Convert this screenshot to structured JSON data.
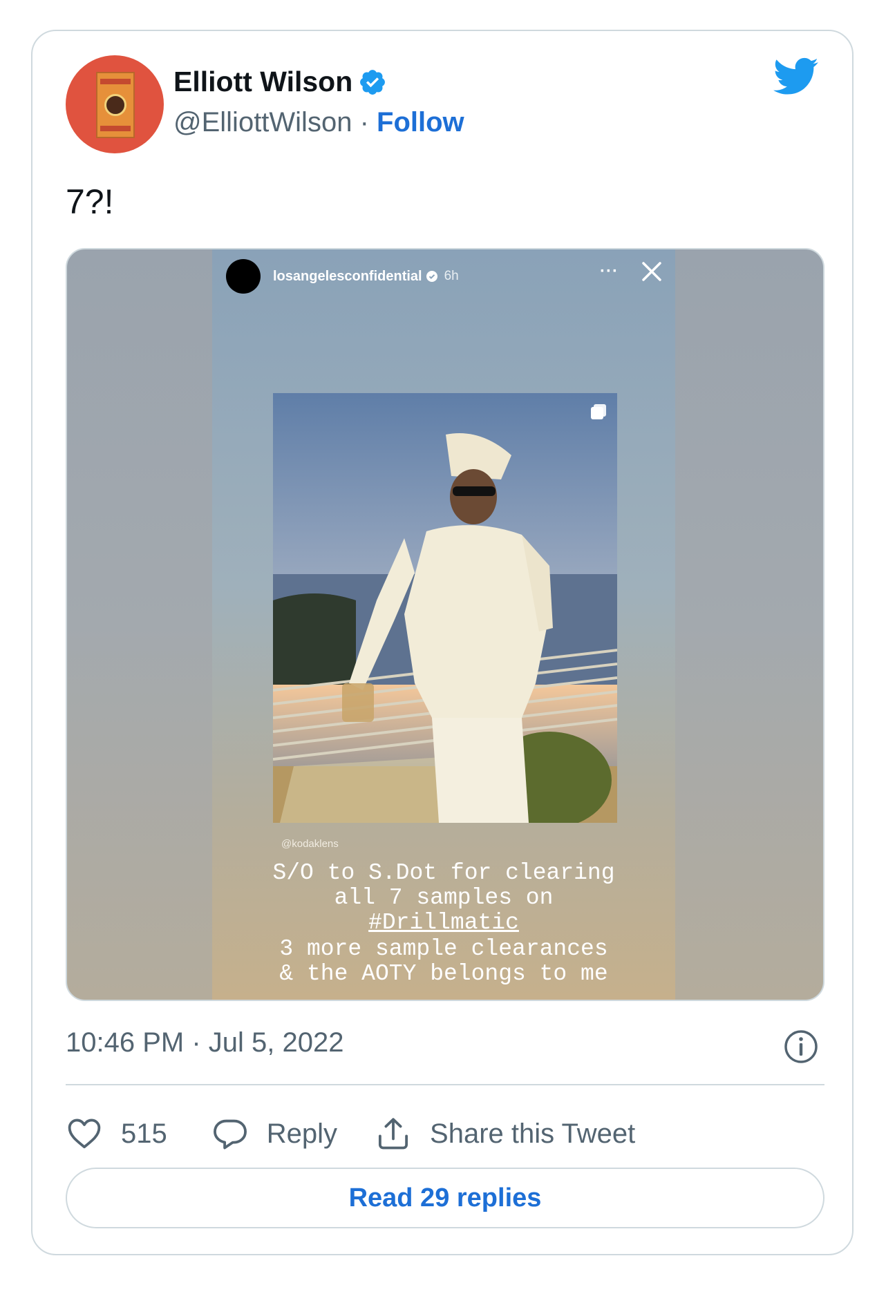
{
  "author": {
    "name": "Elliott Wilson",
    "handle": "@ElliottWilson",
    "separator": "·",
    "follow_label": "Follow",
    "verified": true
  },
  "tweet": {
    "text": "7?!",
    "timestamp": "10:46 PM · Jul 5, 2022"
  },
  "media": {
    "story_user": "losangelesconfidential",
    "story_time": "6h",
    "story_more": "···",
    "photo_credit": "@kodaklens",
    "caption_lines": [
      "S/O to S.Dot for clearing",
      "all 7 samples on",
      "#Drillmatic",
      "3 more sample clearances",
      "& the AOTY belongs to me"
    ]
  },
  "actions": {
    "likes": "515",
    "reply_label": "Reply",
    "share_label": "Share this Tweet"
  },
  "read_replies_label": "Read 29 replies",
  "colors": {
    "accent": "#1d6fd6",
    "twitter_blue": "#1d9bf0",
    "text_secondary": "#536471",
    "border": "#cfd9de"
  },
  "icons": [
    "twitter-bird-icon",
    "verified-badge-icon",
    "info-icon",
    "heart-icon",
    "reply-icon",
    "share-icon",
    "close-icon",
    "copy-icon"
  ]
}
